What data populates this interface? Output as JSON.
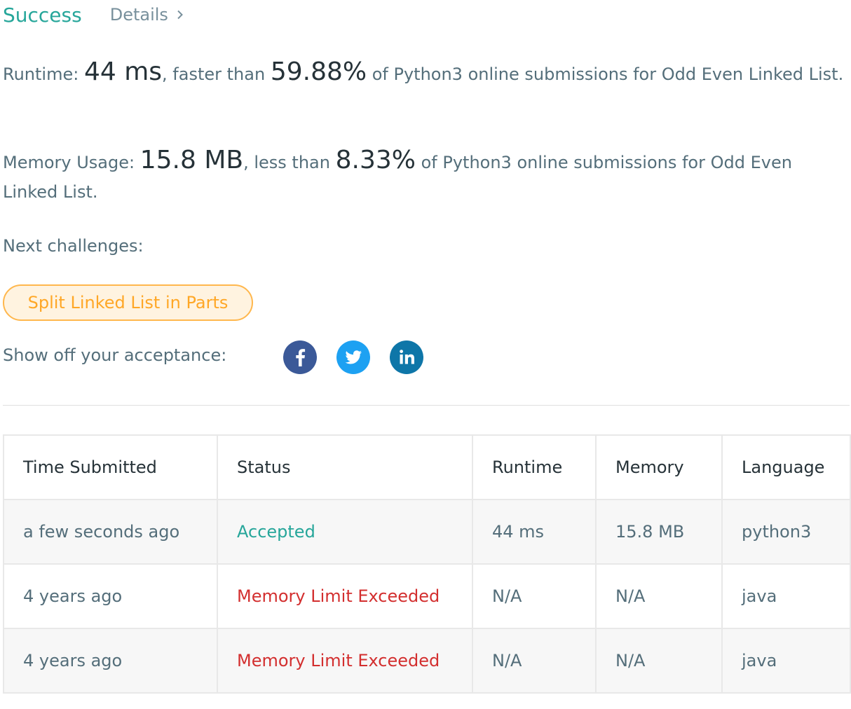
{
  "header": {
    "status": "Success",
    "details_label": "Details",
    "details_icon": "chevron-right-icon"
  },
  "runtime": {
    "label": "Runtime: ",
    "value": "44 ms",
    "comparison": ", faster than ",
    "percentile": "59.88%",
    "suffix": " of Python3 online submissions for Odd Even Linked List."
  },
  "memory": {
    "label": "Memory Usage: ",
    "value": "15.8 MB",
    "comparison": ", less than ",
    "percentile": "8.33%",
    "suffix": " of Python3 online submissions for Odd Even Linked List."
  },
  "next_challenges": {
    "label": "Next challenges:",
    "items": [
      {
        "label": "Split Linked List in Parts"
      }
    ]
  },
  "share": {
    "label": "Show off your acceptance:",
    "icons": [
      "facebook-icon",
      "twitter-icon",
      "linkedin-icon"
    ]
  },
  "submissions": {
    "columns": [
      "Time Submitted",
      "Status",
      "Runtime",
      "Memory",
      "Language"
    ],
    "rows": [
      {
        "time": "a few seconds ago",
        "status": "Accepted",
        "runtime": "44 ms",
        "memory": "15.8 MB",
        "language": "python3"
      },
      {
        "time": "4 years ago",
        "status": "Memory Limit Exceeded",
        "runtime": "N/A",
        "memory": "N/A",
        "language": "java"
      },
      {
        "time": "4 years ago",
        "status": "Memory Limit Exceeded",
        "runtime": "N/A",
        "memory": "N/A",
        "language": "java"
      }
    ]
  },
  "colors": {
    "success": "#26a69a",
    "error": "#d32f2f",
    "challenge_border": "#ffb74d",
    "challenge_bg": "#fff3e0",
    "challenge_text": "#ffa726",
    "facebook": "#3b5998",
    "twitter": "#1da1f2",
    "linkedin": "#0e76a8"
  }
}
